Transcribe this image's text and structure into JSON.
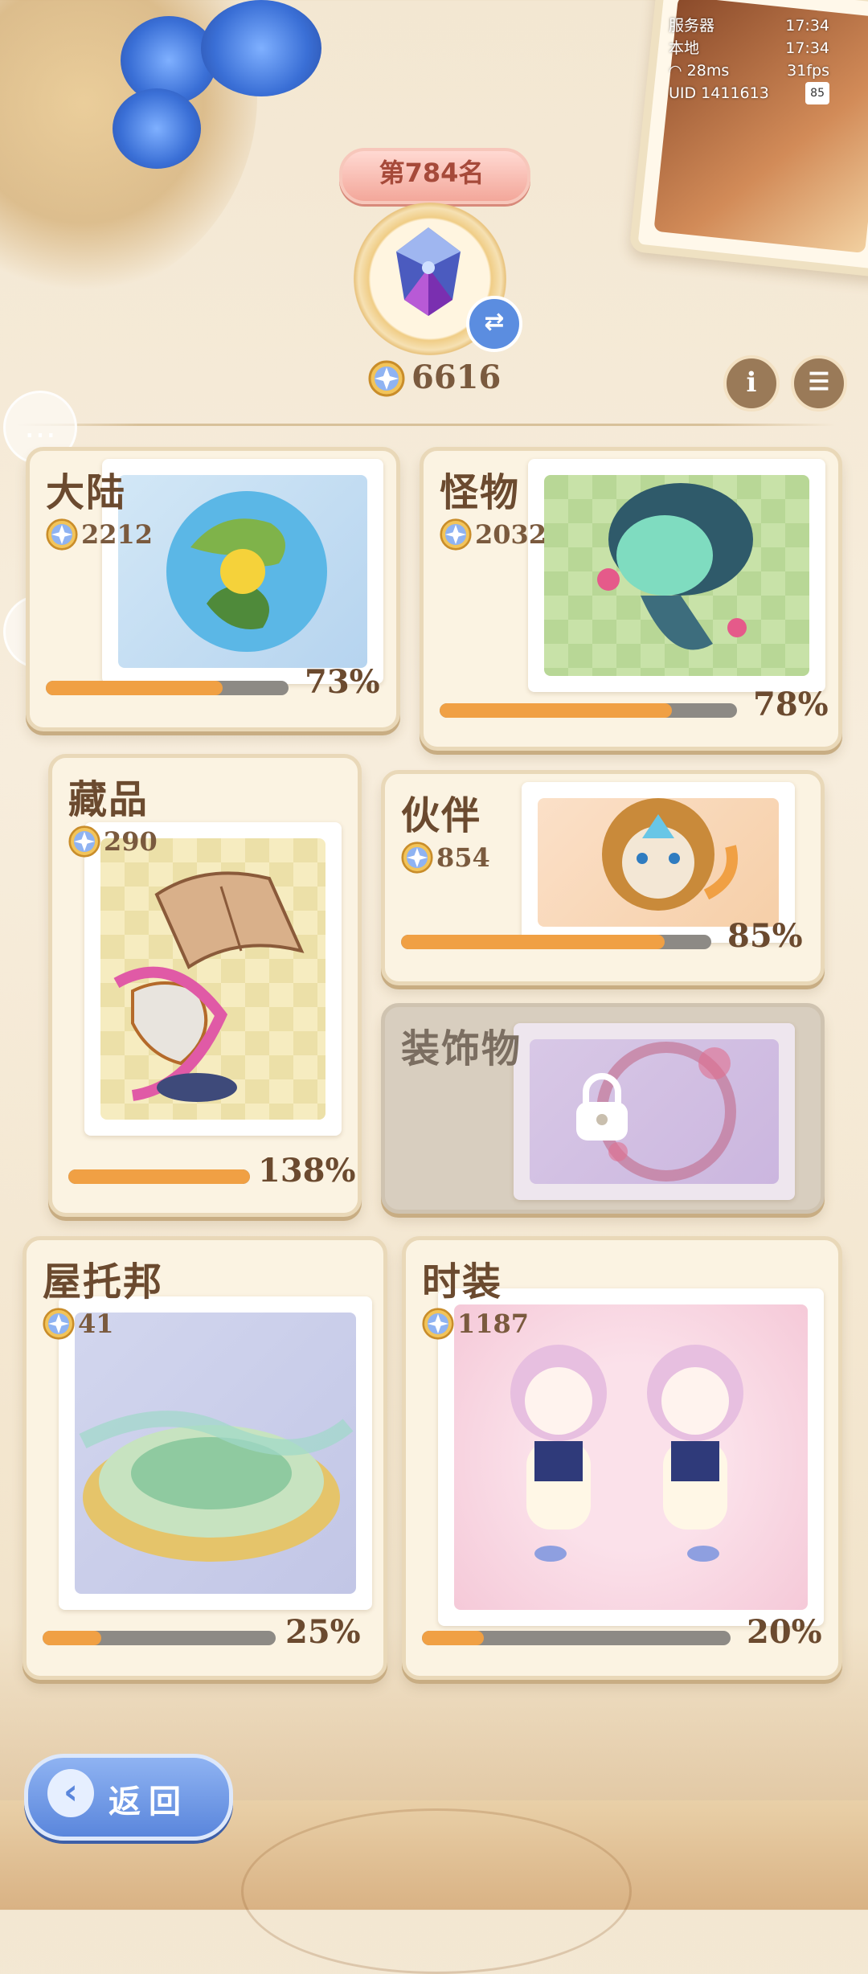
{
  "status": {
    "server_label": "服务器",
    "server_time": "17:34",
    "local_label": "本地",
    "local_time": "17:34",
    "ping": "28ms",
    "fps": "31fps",
    "uid": "UID 1411613",
    "battery": "85"
  },
  "header": {
    "rank": "第784名",
    "score": "6616"
  },
  "cards": {
    "continent": {
      "title": "大陆",
      "points": "2212",
      "percent_label": "73%",
      "progress": 0.73
    },
    "monster": {
      "title": "怪物",
      "points": "2032",
      "percent_label": "78%",
      "progress": 0.78
    },
    "collection": {
      "title": "藏品",
      "points": "290",
      "percent_label": "138%",
      "progress": 1.0
    },
    "partner": {
      "title": "伙伴",
      "points": "854",
      "percent_label": "85%",
      "progress": 0.85
    },
    "decoration": {
      "title": "装饰物",
      "locked": true
    },
    "utopia": {
      "title": "屋托邦",
      "points": "41",
      "percent_label": "25%",
      "progress": 0.25
    },
    "fashion": {
      "title": "时装",
      "points": "1187",
      "percent_label": "20%",
      "progress": 0.2
    }
  },
  "footer": {
    "back_label": "返回"
  },
  "colors": {
    "progress_fill": "#f0a044",
    "progress_track": "#8d8a85",
    "title_text": "#6b4a2f",
    "back_button": "#5a86dc"
  },
  "icons": [
    "star-coin-icon",
    "info-icon",
    "list-icon",
    "chat-icon",
    "robot-icon",
    "swap-icon",
    "lock-icon",
    "chevron-left-icon",
    "wifi-icon"
  ]
}
